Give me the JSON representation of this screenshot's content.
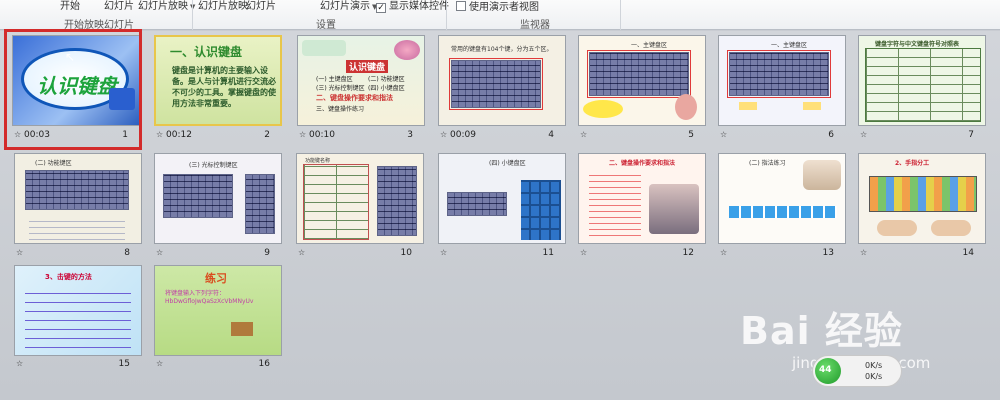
{
  "ribbon": {
    "start_label": "开始",
    "slideshow_label_1": "幻灯片",
    "slideshow_label_2": "幻灯片放映",
    "slideshow_label_3": "幻灯片放映",
    "slideshow_label_4": "幻灯片",
    "group_start_slideshow": "开始放映幻灯片",
    "slides_show_label": "幻灯片演示",
    "show_media_controls": "显示媒体控件",
    "show_media_checked": true,
    "group_setup": "设置",
    "use_presenter_view": "使用演示者视图",
    "use_presenter_checked": false,
    "group_monitor": "监视器"
  },
  "slides": [
    {
      "number": "1",
      "time": "00:03",
      "title": "认识键盘"
    },
    {
      "number": "2",
      "time": "00:12",
      "title": "一、认识键盘",
      "body": "键盘是计算机的主要输入设备。是人与计算机进行交流必不可少的工具。掌握键盘的使用方法非常重要。"
    },
    {
      "number": "3",
      "time": "00:10",
      "title": "认识键盘",
      "items": [
        "(一) 主键盘区",
        "(二) 功能键区",
        "(三) 光标控制键区",
        "(四) 小键盘区",
        "二、键盘操作要求和指法",
        "三、键盘操作练习"
      ]
    },
    {
      "number": "4",
      "time": "00:09",
      "title": "常用的键盘有104个键，分为五个区。"
    },
    {
      "number": "5",
      "time": "",
      "title": "一、主键盘区"
    },
    {
      "number": "6",
      "time": "",
      "title": "一、主键盘区"
    },
    {
      "number": "7",
      "time": "",
      "title": "键盘字符与中文键盘符号对照表"
    },
    {
      "number": "8",
      "time": "",
      "title": "(二) 功能键区"
    },
    {
      "number": "9",
      "time": "",
      "title": "(三) 光标控制键区"
    },
    {
      "number": "10",
      "time": "",
      "title": "功能键名称"
    },
    {
      "number": "11",
      "time": "",
      "title": "(四) 小键盘区"
    },
    {
      "number": "12",
      "time": "",
      "title": "二、键盘操作要求和指法"
    },
    {
      "number": "13",
      "time": "",
      "title": "(二) 指法练习"
    },
    {
      "number": "14",
      "time": "",
      "title": "2、手指分工"
    },
    {
      "number": "15",
      "time": "",
      "title": "3、击键的方法"
    },
    {
      "number": "16",
      "time": "",
      "title": "练习",
      "body": "将键盘输入下列字符：",
      "chars": "HbDwGfloJwQaSzXcVbMNyUv"
    }
  ],
  "watermark": {
    "brand": "Bai 经验",
    "url": "jingyan.baidu.com",
    "net_speed_1": "0K/s",
    "net_speed_2": "0K/s",
    "net_percent": "44"
  }
}
